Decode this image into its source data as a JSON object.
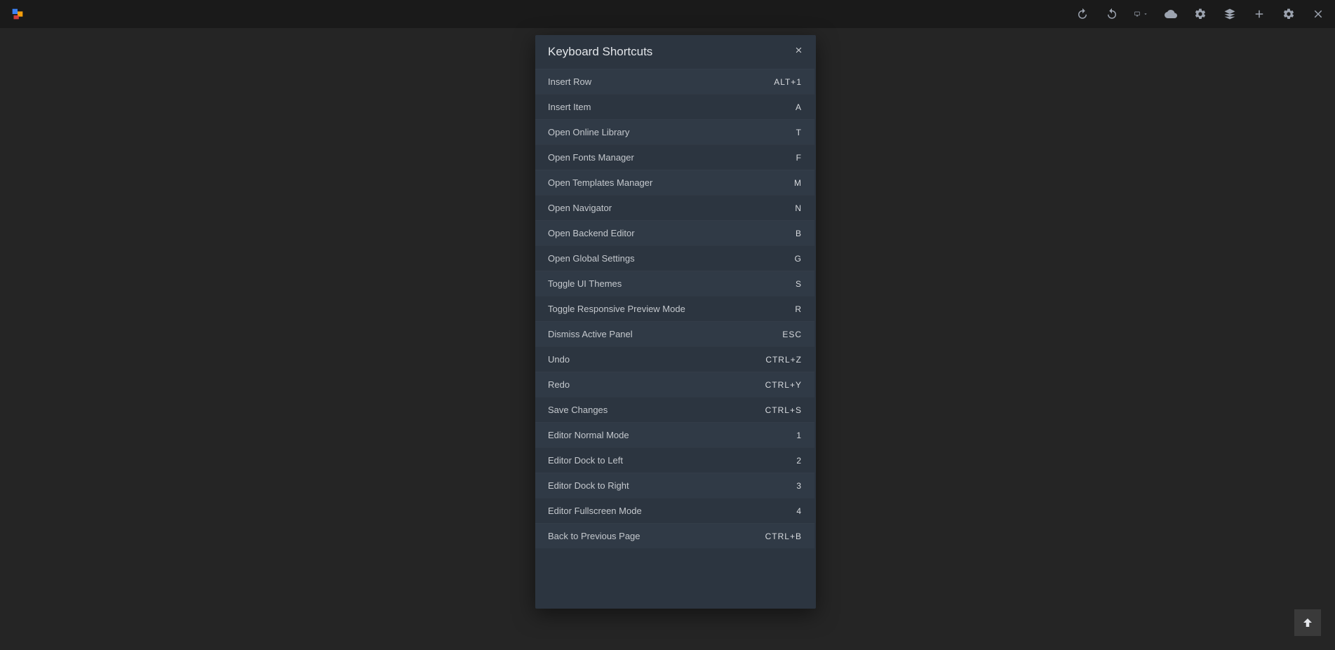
{
  "modal": {
    "title": "Keyboard Shortcuts",
    "shortcuts": [
      {
        "label": "Insert Row",
        "key": "ALT+1"
      },
      {
        "label": "Insert Item",
        "key": "A"
      },
      {
        "label": "Open Online Library",
        "key": "T"
      },
      {
        "label": "Open Fonts Manager",
        "key": "F"
      },
      {
        "label": "Open Templates Manager",
        "key": "M"
      },
      {
        "label": "Open Navigator",
        "key": "N"
      },
      {
        "label": "Open Backend Editor",
        "key": "B"
      },
      {
        "label": "Open Global Settings",
        "key": "G"
      },
      {
        "label": "Toggle UI Themes",
        "key": "S"
      },
      {
        "label": "Toggle Responsive Preview Mode",
        "key": "R"
      },
      {
        "label": "Dismiss Active Panel",
        "key": "ESC"
      },
      {
        "label": "Undo",
        "key": "CTRL+Z"
      },
      {
        "label": "Redo",
        "key": "CTRL+Y"
      },
      {
        "label": "Save Changes",
        "key": "CTRL+S"
      },
      {
        "label": "Editor Normal Mode",
        "key": "1"
      },
      {
        "label": "Editor Dock to Left",
        "key": "2"
      },
      {
        "label": "Editor Dock to Right",
        "key": "3"
      },
      {
        "label": "Editor Fullscreen Mode",
        "key": "4"
      },
      {
        "label": "Back to Previous Page",
        "key": "CTRL+B"
      }
    ]
  }
}
